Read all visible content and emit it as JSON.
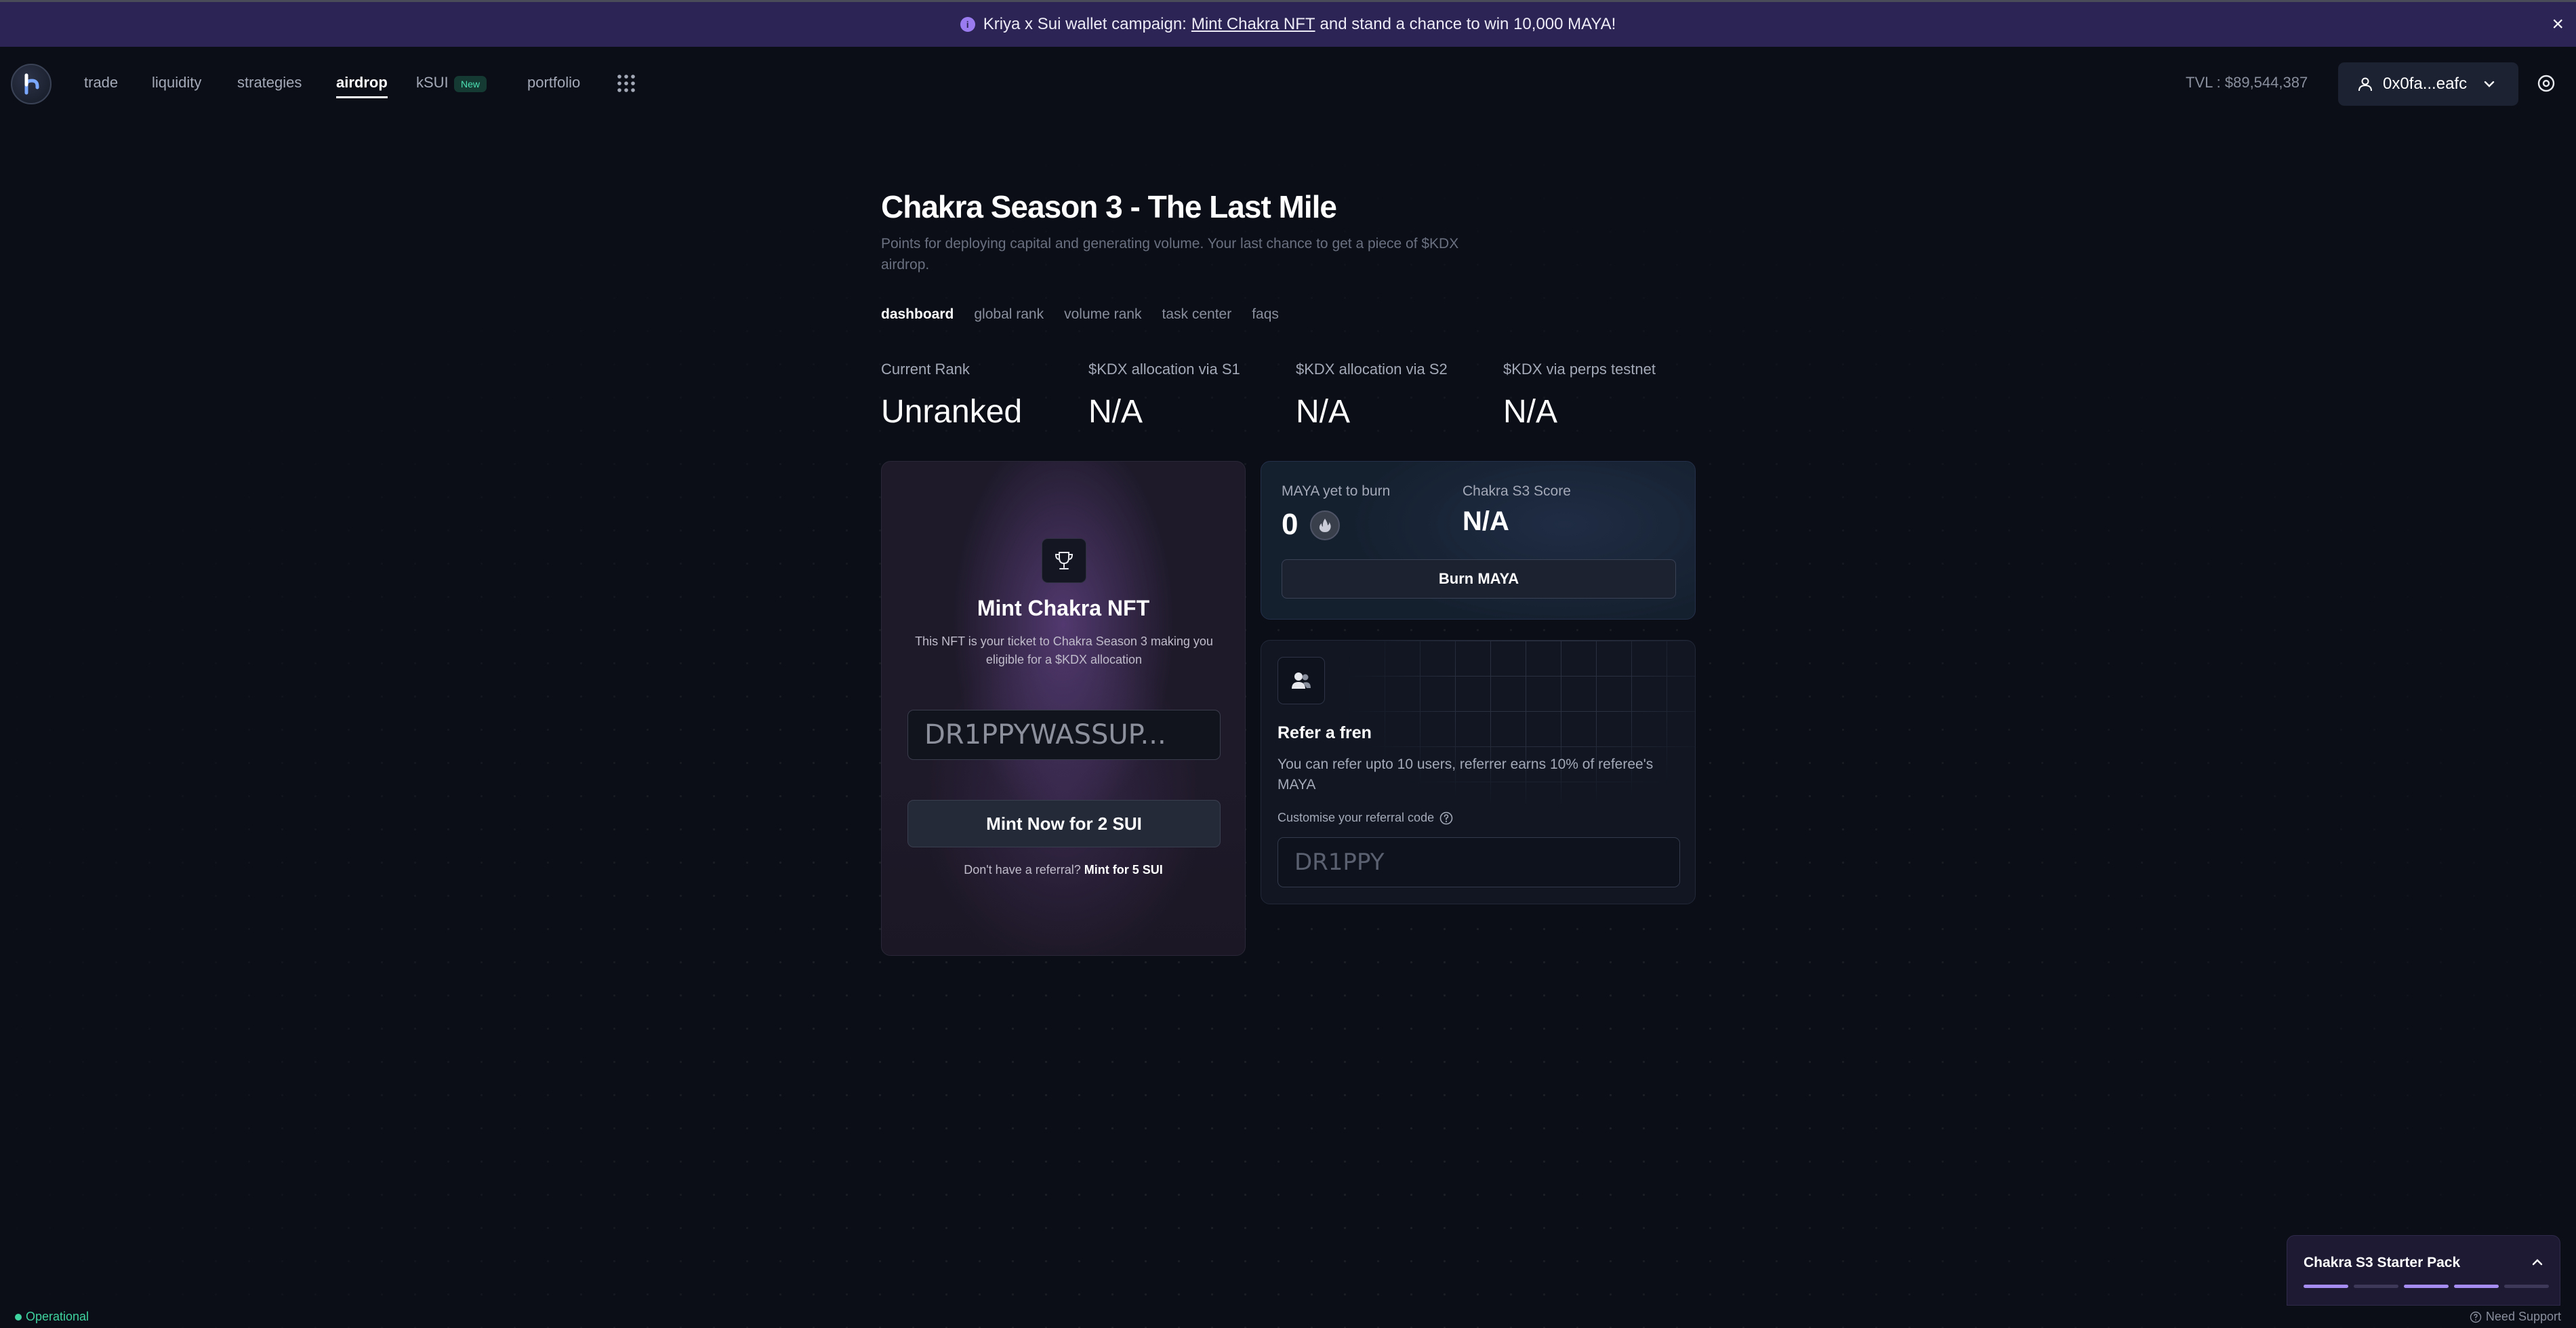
{
  "banner": {
    "prefix": "Kriya x Sui wallet campaign:",
    "link": "Mint Chakra NFT",
    "suffix": "and stand a chance to win 10,000 MAYA!",
    "close": "×"
  },
  "nav": {
    "items": [
      "trade",
      "liquidity",
      "strategies",
      "airdrop",
      "kSUI",
      "portfolio"
    ],
    "active": "airdrop",
    "new_badge": "New",
    "tvl": "TVL : $89,544,387",
    "wallet": "0x0fa...eafc"
  },
  "page": {
    "title": "Chakra Season 3 - The Last Mile",
    "subtitle": "Points for deploying capital and generating volume. Your last chance to get a piece of $KDX airdrop.",
    "tabs": [
      "dashboard",
      "global rank",
      "volume rank",
      "task center",
      "faqs"
    ],
    "active_tab": "dashboard"
  },
  "stats": [
    {
      "label": "Current Rank",
      "value": "Unranked"
    },
    {
      "label": "$KDX allocation via S1",
      "value": "N/A"
    },
    {
      "label": "$KDX allocation via S2",
      "value": "N/A"
    },
    {
      "label": "$KDX via perps testnet",
      "value": "N/A"
    }
  ],
  "mint": {
    "title": "Mint Chakra NFT",
    "description": "This NFT is your ticket to Chakra Season 3 making you eligible for a $KDX allocation",
    "input_placeholder": "DR1PPYWASSUP...",
    "button": "Mint Now for 2 SUI",
    "footer_text": "Don't have a referral?",
    "footer_link": "Mint for 5 SUI"
  },
  "burn": {
    "maya_label": "MAYA yet to burn",
    "maya_value": "0",
    "score_label": "Chakra S3 Score",
    "score_value": "N/A",
    "button": "Burn MAYA"
  },
  "refer": {
    "title": "Refer a fren",
    "description": "You can refer upto 10 users, referrer earns 10% of referee's MAYA",
    "label": "Customise your referral code",
    "input_placeholder": "DR1PPY"
  },
  "starter_pack": {
    "title": "Chakra S3 Starter Pack",
    "progress": [
      true,
      false,
      true,
      true,
      false
    ]
  },
  "footer": {
    "status": "Operational",
    "support": "Need Support"
  },
  "colors": {
    "accent": "#a58cf2",
    "banner_bg": "#2c2454",
    "status_green": "#3fd3a0",
    "background": "#0b0e16"
  }
}
